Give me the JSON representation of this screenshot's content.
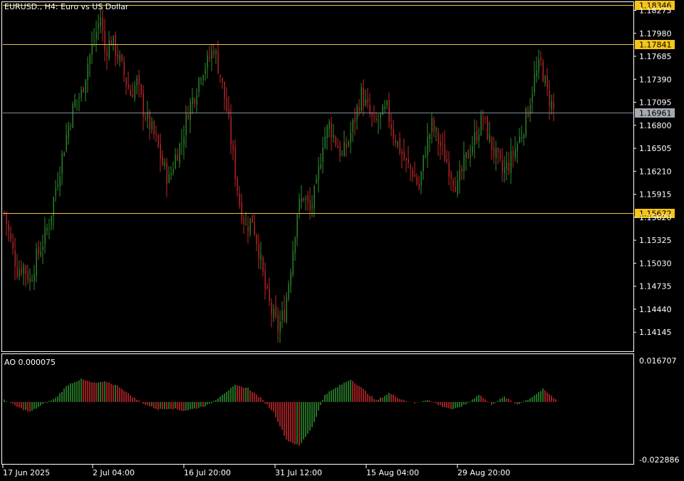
{
  "chart_title": "EURUSD., H4:  Euro vs US Dollar",
  "ao_label": "AO 0.000075",
  "colors": {
    "background": "#000000",
    "bull": "#2E8B2E",
    "bear": "#C0282A",
    "axis": "#FFFFFF",
    "hline": "#E8C547",
    "bid_line": "#7F8C99",
    "price_tag_yellow": "#F5C518",
    "price_tag_gray": "#A5AAB0"
  },
  "chart_data": [
    {
      "type": "candlestick",
      "title": "EURUSD., H4:  Euro vs US Dollar",
      "ylim": [
        1.139,
        1.1838
      ],
      "y_ticks": [
        "1.18275",
        "1.17980",
        "1.17685",
        "1.17390",
        "1.17095",
        "1.16800",
        "1.16505",
        "1.16210",
        "1.15915",
        "1.15620",
        "1.15325",
        "1.15030",
        "1.14735",
        "1.14440",
        "1.14145"
      ],
      "x_ticks": [
        "17 Jun 2025",
        "2 Jul 04:00",
        "16 Jul 20:00",
        "31 Jul 12:00",
        "15 Aug 04:00",
        "29 Aug 20:00"
      ],
      "horizontal_lines": [
        {
          "price": "1.18346",
          "style": "level"
        },
        {
          "price": "1.17841",
          "style": "level"
        },
        {
          "price": "1.15672",
          "style": "level"
        },
        {
          "price": "1.16961",
          "style": "bid"
        }
      ],
      "close_path_points": [
        [
          0,
          1.1568
        ],
        [
          3,
          1.153
        ],
        [
          6,
          1.1495
        ],
        [
          9,
          1.15
        ],
        [
          12,
          1.148
        ],
        [
          15,
          1.151
        ],
        [
          18,
          1.153
        ],
        [
          21,
          1.1555
        ],
        [
          24,
          1.16
        ],
        [
          27,
          1.164
        ],
        [
          30,
          1.168
        ],
        [
          33,
          1.171
        ],
        [
          36,
          1.172
        ],
        [
          39,
          1.176
        ],
        [
          42,
          1.179
        ],
        [
          45,
          1.182
        ],
        [
          47,
          1.1775
        ],
        [
          50,
          1.179
        ],
        [
          53,
          1.177
        ],
        [
          56,
          1.1745
        ],
        [
          59,
          1.172
        ],
        [
          62,
          1.1735
        ],
        [
          65,
          1.17
        ],
        [
          68,
          1.168
        ],
        [
          71,
          1.166
        ],
        [
          74,
          1.163
        ],
        [
          77,
          1.161
        ],
        [
          80,
          1.164
        ],
        [
          83,
          1.166
        ],
        [
          86,
          1.17
        ],
        [
          89,
          1.172
        ],
        [
          92,
          1.175
        ],
        [
          95,
          1.176
        ],
        [
          98,
          1.178
        ],
        [
          101,
          1.1745
        ],
        [
          104,
          1.17
        ],
        [
          107,
          1.164
        ],
        [
          110,
          1.158
        ],
        [
          113,
          1.155
        ],
        [
          116,
          1.156
        ],
        [
          119,
          1.152
        ],
        [
          122,
          1.147
        ],
        [
          125,
          1.144
        ],
        [
          128,
          1.142
        ],
        [
          131,
          1.144
        ],
        [
          134,
          1.15
        ],
        [
          137,
          1.157
        ],
        [
          140,
          1.159
        ],
        [
          143,
          1.157
        ],
        [
          146,
          1.16
        ],
        [
          149,
          1.166
        ],
        [
          152,
          1.168
        ],
        [
          155,
          1.166
        ],
        [
          158,
          1.164
        ],
        [
          161,
          1.166
        ],
        [
          164,
          1.169
        ],
        [
          167,
          1.172
        ],
        [
          170,
          1.17
        ],
        [
          173,
          1.168
        ],
        [
          176,
          1.169
        ],
        [
          179,
          1.17
        ],
        [
          182,
          1.167
        ],
        [
          185,
          1.165
        ],
        [
          188,
          1.163
        ],
        [
          191,
          1.162
        ],
        [
          194,
          1.16
        ],
        [
          197,
          1.165
        ],
        [
          200,
          1.168
        ],
        [
          203,
          1.166
        ],
        [
          206,
          1.164
        ],
        [
          209,
          1.162
        ],
        [
          212,
          1.16
        ],
        [
          215,
          1.163
        ],
        [
          218,
          1.165
        ],
        [
          221,
          1.167
        ],
        [
          224,
          1.169
        ],
        [
          227,
          1.166
        ],
        [
          230,
          1.164
        ],
        [
          233,
          1.162
        ],
        [
          236,
          1.163
        ],
        [
          239,
          1.165
        ],
        [
          242,
          1.167
        ],
        [
          245,
          1.17
        ],
        [
          248,
          1.174
        ],
        [
          251,
          1.176
        ],
        [
          254,
          1.172
        ],
        [
          257,
          1.17
        ]
      ]
    },
    {
      "type": "bar",
      "title": "AO 0.000075",
      "ylim": [
        -0.022886,
        0.016707
      ],
      "y_ticks": [
        "0.016707",
        "-0.022886"
      ],
      "ao_path_points": [
        [
          0,
          0.001
        ],
        [
          6,
          -0.002
        ],
        [
          12,
          -0.004
        ],
        [
          18,
          -0.001
        ],
        [
          24,
          0.0015
        ],
        [
          30,
          0.007
        ],
        [
          36,
          0.009
        ],
        [
          42,
          0.0075
        ],
        [
          48,
          0.008
        ],
        [
          54,
          0.006
        ],
        [
          60,
          0.002
        ],
        [
          66,
          -0.001
        ],
        [
          72,
          -0.003
        ],
        [
          78,
          -0.0025
        ],
        [
          84,
          -0.0035
        ],
        [
          90,
          -0.0025
        ],
        [
          96,
          -0.001
        ],
        [
          102,
          0.003
        ],
        [
          108,
          0.0065
        ],
        [
          114,
          0.0055
        ],
        [
          120,
          0.0015
        ],
        [
          126,
          -0.004
        ],
        [
          132,
          -0.015
        ],
        [
          138,
          -0.0175
        ],
        [
          144,
          -0.01
        ],
        [
          150,
          0.003
        ],
        [
          156,
          0.006
        ],
        [
          162,
          0.009
        ],
        [
          168,
          0.005
        ],
        [
          174,
          0.0005
        ],
        [
          180,
          0.0035
        ],
        [
          186,
          0.001
        ],
        [
          192,
          -0.0005
        ],
        [
          198,
          0.001
        ],
        [
          204,
          -0.0015
        ],
        [
          210,
          -0.003
        ],
        [
          216,
          -0.001
        ],
        [
          222,
          0.003
        ],
        [
          228,
          -0.001
        ],
        [
          234,
          0.002
        ],
        [
          240,
          -0.001
        ],
        [
          246,
          0.0015
        ],
        [
          252,
          0.005
        ],
        [
          258,
          0.001
        ]
      ]
    }
  ]
}
